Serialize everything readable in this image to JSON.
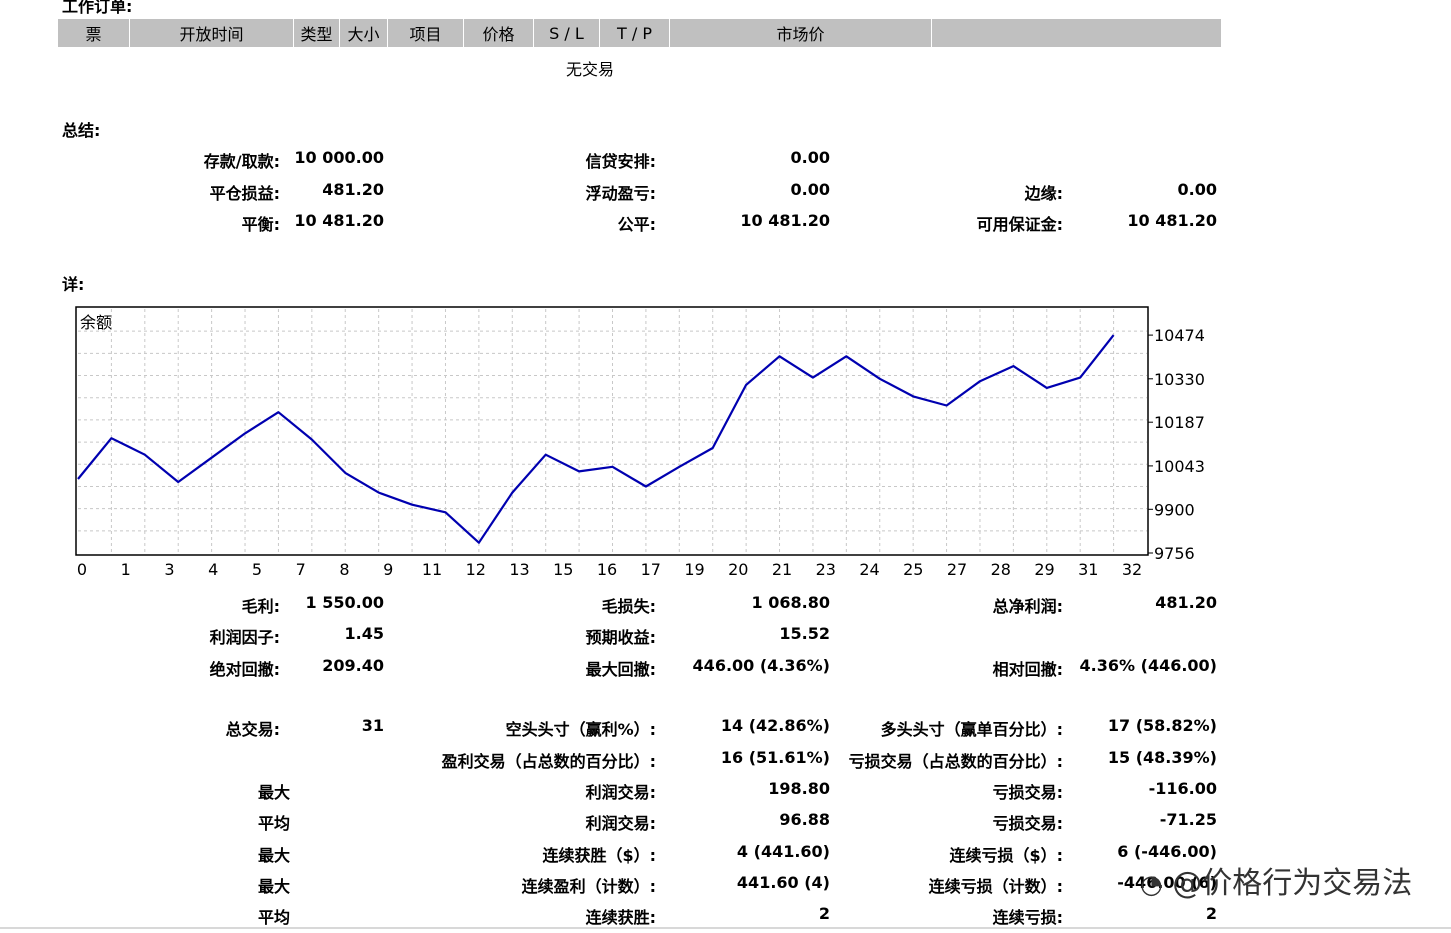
{
  "working_orders": {
    "title": "工作订单:",
    "columns": [
      "票",
      "开放时间",
      "类型",
      "大小",
      "项目",
      "价格",
      "S / L",
      "T / P",
      "市场价",
      ""
    ],
    "empty_text": "无交易"
  },
  "summary": {
    "title": "总结:",
    "rows": [
      {
        "l1": "存款/取款:",
        "v1": "10 000.00",
        "l2": "信贷安排:",
        "v2": "0.00",
        "l3": "",
        "v3": ""
      },
      {
        "l1": "平仓损益:",
        "v1": "481.20",
        "l2": "浮动盈亏:",
        "v2": "0.00",
        "l3": "边缘:",
        "v3": "0.00"
      },
      {
        "l1": "平衡:",
        "v1": "10 481.20",
        "l2": "公平:",
        "v2": "10 481.20",
        "l3": "可用保证金:",
        "v3": "10 481.20"
      }
    ]
  },
  "details": {
    "title": "详:"
  },
  "chart_data": {
    "type": "line",
    "series": [
      {
        "name": "余额",
        "color": "#0000b0",
        "x": [
          0,
          1,
          2,
          3,
          4,
          5,
          6,
          7,
          8,
          9,
          10,
          11,
          12,
          13,
          14,
          15,
          16,
          17,
          18,
          19,
          20,
          21,
          22,
          23,
          24,
          25,
          26,
          27,
          28,
          29,
          30,
          31
        ],
        "y": [
          10000,
          10134.2,
          10080,
          9990,
          10070,
          10150,
          10220,
          10130,
          10020,
          9955,
          9915,
          9890,
          9790,
          9955,
          10080,
          10025,
          10040,
          9975,
          10040,
          10102,
          10310,
          10404,
          10334,
          10404,
          10330,
          10272,
          10242,
          10322,
          10372,
          10300,
          10334,
          10474
        ]
      }
    ],
    "x_ticks": [
      "0",
      "1",
      "3",
      "4",
      "5",
      "7",
      "8",
      "9",
      "11",
      "12",
      "13",
      "15",
      "16",
      "17",
      "19",
      "20",
      "21",
      "23",
      "24",
      "25",
      "27",
      "28",
      "29",
      "31",
      "32"
    ],
    "y_ticks": [
      "10474",
      "10330",
      "10187",
      "10043",
      "9900",
      "9756"
    ],
    "xlim": [
      0,
      32
    ],
    "ylim": [
      9756,
      10560
    ],
    "grid": true
  },
  "stats": {
    "r1": {
      "l1": "毛利:",
      "v1": "1 550.00",
      "l2": "毛损失:",
      "v2": "1 068.80",
      "l3": "总净利润:",
      "v3": "481.20"
    },
    "r2": {
      "l1": "利润因子:",
      "v1": "1.45",
      "l2": "预期收益:",
      "v2": "15.52"
    },
    "r3": {
      "l1": "绝对回撤:",
      "v1": "209.40",
      "l2": "最大回撤:",
      "v2": "446.00 (4.36%)",
      "l3": "相对回撤:",
      "v3": "4.36% (446.00)"
    },
    "r4": {
      "l1": "总交易:",
      "v1": "31",
      "l2": "空头头寸（赢利%）:",
      "v2": "14 (42.86%)",
      "l3": "多头头寸（赢单百分比）:",
      "v3": "17 (58.82%)"
    },
    "r5": {
      "l2": "盈利交易（占总数的百分比）:",
      "v2": "16 (51.61%)",
      "l3": "亏损交易（占总数的百分比）:",
      "v3": "15 (48.39%)"
    },
    "r6": {
      "l1": "最大",
      "l2": "利润交易:",
      "v2": "198.80",
      "l3": "亏损交易:",
      "v3": "-116.00"
    },
    "r7": {
      "l1": "平均",
      "l2": "利润交易:",
      "v2": "96.88",
      "l3": "亏损交易:",
      "v3": "-71.25"
    },
    "r8": {
      "l1": "最大",
      "l2": "连续获胜（$）:",
      "v2": "4 (441.60)",
      "l3": "连续亏损（$）:",
      "v3": "6 (-446.00)"
    },
    "r9": {
      "l1": "最大",
      "l2": "连续盈利（计数）:",
      "v2": "441.60 (4)",
      "l3": "连续亏损（计数）:",
      "v3": "-446.00 (6)"
    },
    "r10": {
      "l1": "平均",
      "l2": "连续获胜:",
      "v2": "2",
      "l3": "连续亏损:",
      "v3": "2"
    }
  },
  "watermark": {
    "text": "@价格行为交易法"
  }
}
